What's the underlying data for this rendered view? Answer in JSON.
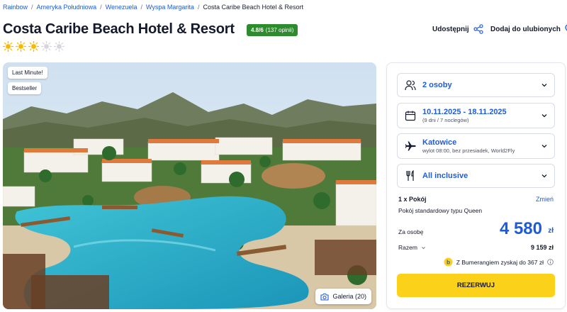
{
  "breadcrumb": [
    "Rainbow",
    "Ameryka Południowa",
    "Wenezuela",
    "Wyspa Margarita"
  ],
  "breadcrumb_current": "Costa Caribe Beach Hotel & Resort",
  "hotel": {
    "name": "Costa Caribe Beach Hotel & Resort",
    "rating": "4.8/6",
    "reviews": "(137 opinii)",
    "stars_filled": 3,
    "stars_total": 5
  },
  "actions": {
    "share": "Udostępnij",
    "favorite": "Dodaj do ulubionych"
  },
  "photo": {
    "badges": [
      "Last Minute!",
      "Bestseller"
    ],
    "gallery": "Galeria (20)"
  },
  "booking": {
    "people": "2 osoby",
    "dates": "10.11.2025 - 18.11.2025",
    "dates_sub": "(9 dni / 7 noclegów)",
    "departure": "Katowice",
    "departure_sub": "wylot 08:00, bez przesiadek, World2Fly",
    "board": "All inclusive",
    "rooms": "1 x Pokój",
    "change": "Zmień",
    "room_type": "Pokój standardowy typu Queen",
    "per_person_label": "Za osobę",
    "price": "4 580",
    "currency": "zł",
    "total_label": "Razem",
    "total": "9 159 zł",
    "bumerang": "Z Bumerangiem zyskaj do 367 zł",
    "book": "REZERWUJ"
  },
  "colors": {
    "accent": "#1e5bd8",
    "cta": "#fcd11a",
    "rating": "#2e8b2e",
    "star": "#f6b800"
  }
}
